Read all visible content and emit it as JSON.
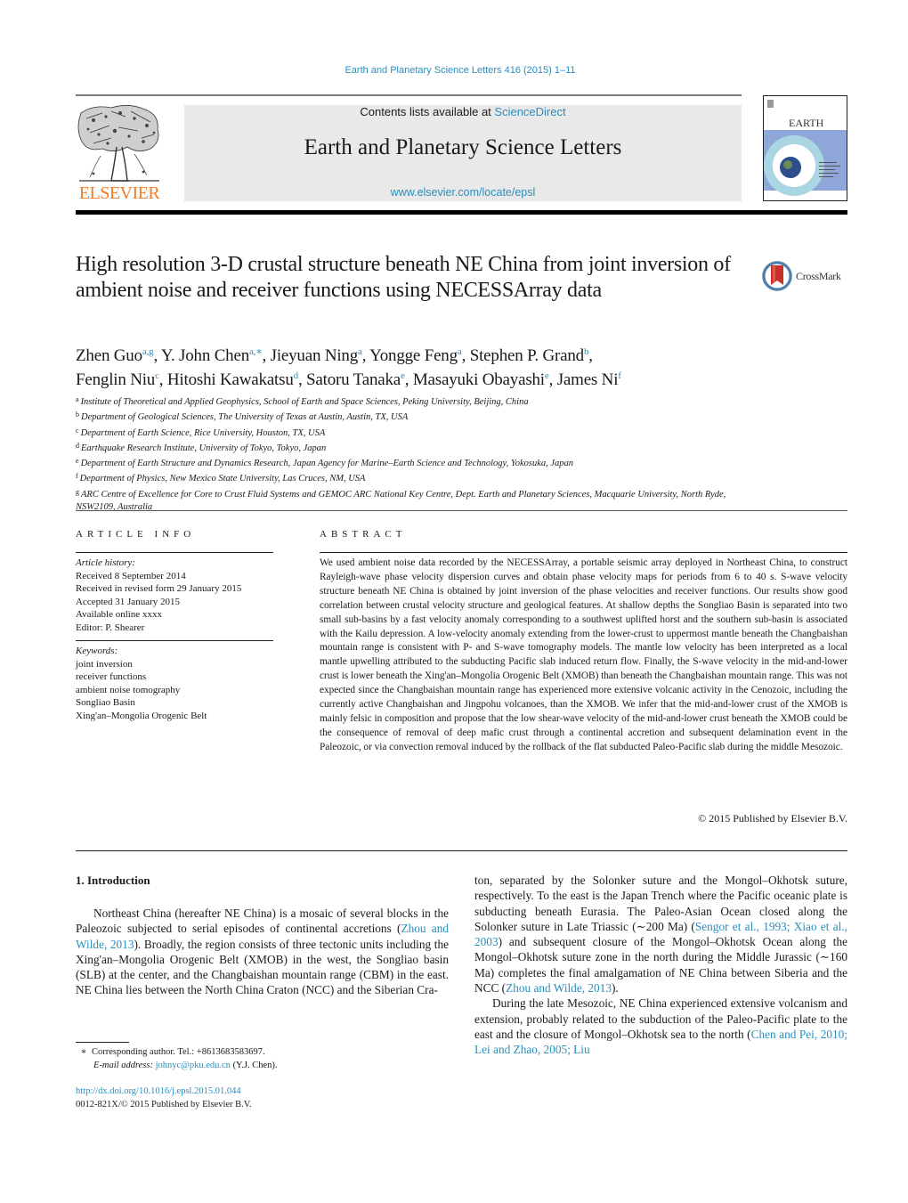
{
  "journal_ref": "Earth and Planetary Science Letters 416 (2015) 1–11",
  "masthead": {
    "contents_prefix": "Contents lists available at ",
    "contents_link": "ScienceDirect",
    "journal_title": "Earth and Planetary Science Letters",
    "journal_url": "www.elsevier.com/locate/epsl",
    "publisher_wordmark": "ELSEVIER",
    "cover_title": "EARTH",
    "cover_subtitle": "& PLANETARY SCIENCE LETTERS"
  },
  "article": {
    "title": "High resolution 3-D crustal structure beneath NE China from joint inversion of ambient noise and receiver functions using NECESSArray data",
    "crossmark_label": "CrossMark",
    "authors": [
      {
        "name": "Zhen Guo",
        "sup": "a,g",
        "sep": ", "
      },
      {
        "name": "Y. John Chen",
        "sup": "a,∗",
        "sep": ", "
      },
      {
        "name": "Jieyuan Ning",
        "sup": "a",
        "sep": ", "
      },
      {
        "name": "Yongge Feng",
        "sup": "a",
        "sep": ", "
      },
      {
        "name": "Stephen P. Grand",
        "sup": "b",
        "sep": ","
      },
      {
        "name": "Fenglin Niu",
        "sup": "c",
        "sep": ", "
      },
      {
        "name": "Hitoshi Kawakatsu",
        "sup": "d",
        "sep": ", "
      },
      {
        "name": "Satoru Tanaka",
        "sup": "e",
        "sep": ", "
      },
      {
        "name": "Masayuki Obayashi",
        "sup": "e",
        "sep": ", "
      },
      {
        "name": "James Ni",
        "sup": "f",
        "sep": ""
      }
    ],
    "affiliations": [
      {
        "key": "a",
        "text": "Institute of Theoretical and Applied Geophysics, School of Earth and Space Sciences, Peking University, Beijing, China"
      },
      {
        "key": "b",
        "text": "Department of Geological Sciences, The University of Texas at Austin, Austin, TX, USA"
      },
      {
        "key": "c",
        "text": "Department of Earth Science, Rice University, Houston, TX, USA"
      },
      {
        "key": "d",
        "text": "Earthquake Research Institute, University of Tokyo, Tokyo, Japan"
      },
      {
        "key": "e",
        "text": "Department of Earth Structure and Dynamics Research, Japan Agency for Marine–Earth Science and Technology, Yokosuka, Japan"
      },
      {
        "key": "f",
        "text": "Department of Physics, New Mexico State University, Las Cruces, NM, USA"
      },
      {
        "key": "g",
        "text": "ARC Centre of Excellence for Core to Crust Fluid Systems and GEMOC ARC National Key Centre, Dept. Earth and Planetary Sciences, Macquarie University, North Ryde, NSW2109, Australia"
      }
    ]
  },
  "article_info": {
    "heading": "ARTICLE INFO",
    "history_label": "Article history:",
    "history": [
      "Received 8 September 2014",
      "Received in revised form 29 January 2015",
      "Accepted 31 January 2015",
      "Available online xxxx",
      "Editor: P. Shearer"
    ],
    "keywords_label": "Keywords:",
    "keywords": [
      "joint inversion",
      "receiver functions",
      "ambient noise tomography",
      "Songliao Basin",
      "Xing'an–Mongolia Orogenic Belt"
    ]
  },
  "abstract": {
    "heading": "ABSTRACT",
    "text": "We used ambient noise data recorded by the NECESSArray, a portable seismic array deployed in Northeast China, to construct Rayleigh-wave phase velocity dispersion curves and obtain phase velocity maps for periods from 6 to 40 s. S-wave velocity structure beneath NE China is obtained by joint inversion of the phase velocities and receiver functions. Our results show good correlation between crustal velocity structure and geological features. At shallow depths the Songliao Basin is separated into two small sub-basins by a fast velocity anomaly corresponding to a southwest uplifted horst and the southern sub-basin is associated with the Kailu depression. A low-velocity anomaly extending from the lower-crust to uppermost mantle beneath the Changbaishan mountain range is consistent with P- and S-wave tomography models. The mantle low velocity has been interpreted as a local mantle upwelling attributed to the subducting Pacific slab induced return flow. Finally, the S-wave velocity in the mid-and-lower crust is lower beneath the Xing'an–Mongolia Orogenic Belt (XMOB) than beneath the Changbaishan mountain range. This was not expected since the Changbaishan mountain range has experienced more extensive volcanic activity in the Cenozoic, including the currently active Changbaishan and Jingpohu volcanoes, than the XMOB. We infer that the mid-and-lower crust of the XMOB is mainly felsic in composition and propose that the low shear-wave velocity of the mid-and-lower crust beneath the XMOB could be the consequence of removal of deep mafic crust through a continental accretion and subsequent delamination event in the Paleozoic, or via convection removal induced by the rollback of the flat subducted Paleo-Pacific slab during the middle Mesozoic.",
    "copyright": "© 2015 Published by Elsevier B.V."
  },
  "body": {
    "section_heading": "1. Introduction",
    "left_p1": [
      {
        "t": "Northeast China (hereafter NE China) is a mosaic of several blocks in the Paleozoic subjected to serial episodes of continental accretions ("
      },
      {
        "t": "Zhou and Wilde, 2013",
        "link": true
      },
      {
        "t": "). Broadly, the region consists of three tectonic units including the Xing'an–Mongolia Orogenic Belt (XMOB) in the west, the Songliao basin (SLB) at the center, and the Changbaishan mountain range (CBM) in the east. NE China lies between the North China Craton (NCC) and the Siberian Cra-"
      }
    ],
    "right_p1": [
      {
        "t": "ton, separated by the Solonker suture and the Mongol–Okhotsk suture, respectively. To the east is the Japan Trench where the Pacific oceanic plate is subducting beneath Eurasia. The Paleo-Asian Ocean closed along the Solonker suture in Late Triassic (∼200 Ma) ("
      },
      {
        "t": "Sengor et al., 1993; Xiao et al., 2003",
        "link": true
      },
      {
        "t": ") and subsequent closure of the Mongol–Okhotsk Ocean along the Mongol–Okhotsk suture zone in the north during the Middle Jurassic (∼160 Ma) completes the final amalgamation of NE China between Siberia and the NCC ("
      },
      {
        "t": "Zhou and Wilde, 2013",
        "link": true
      },
      {
        "t": ")."
      }
    ],
    "right_p2": [
      {
        "t": "During the late Mesozoic, NE China experienced extensive volcanism and extension, probably related to the subduction of the Paleo-Pacific plate to the east and the closure of Mongol–Okhotsk sea to the north ("
      },
      {
        "t": "Chen and Pei, 2010; Lei and Zhao, 2005; Liu",
        "link": true
      }
    ]
  },
  "footnotes": {
    "star": "∗",
    "corresponding": "Corresponding author. Tel.: +8613683583697.",
    "email_label": "E-mail address:",
    "email": "johnyc@pku.edu.cn",
    "email_suffix": " (Y.J. Chen).",
    "doi": "http://dx.doi.org/10.1016/j.epsl.2015.01.044",
    "issn_line": "0012-821X/© 2015 Published by Elsevier B.V."
  },
  "colors": {
    "link": "#2a8fbd",
    "elsevier_orange": "#f47b20",
    "masthead_bg": "#e9e9e9"
  }
}
